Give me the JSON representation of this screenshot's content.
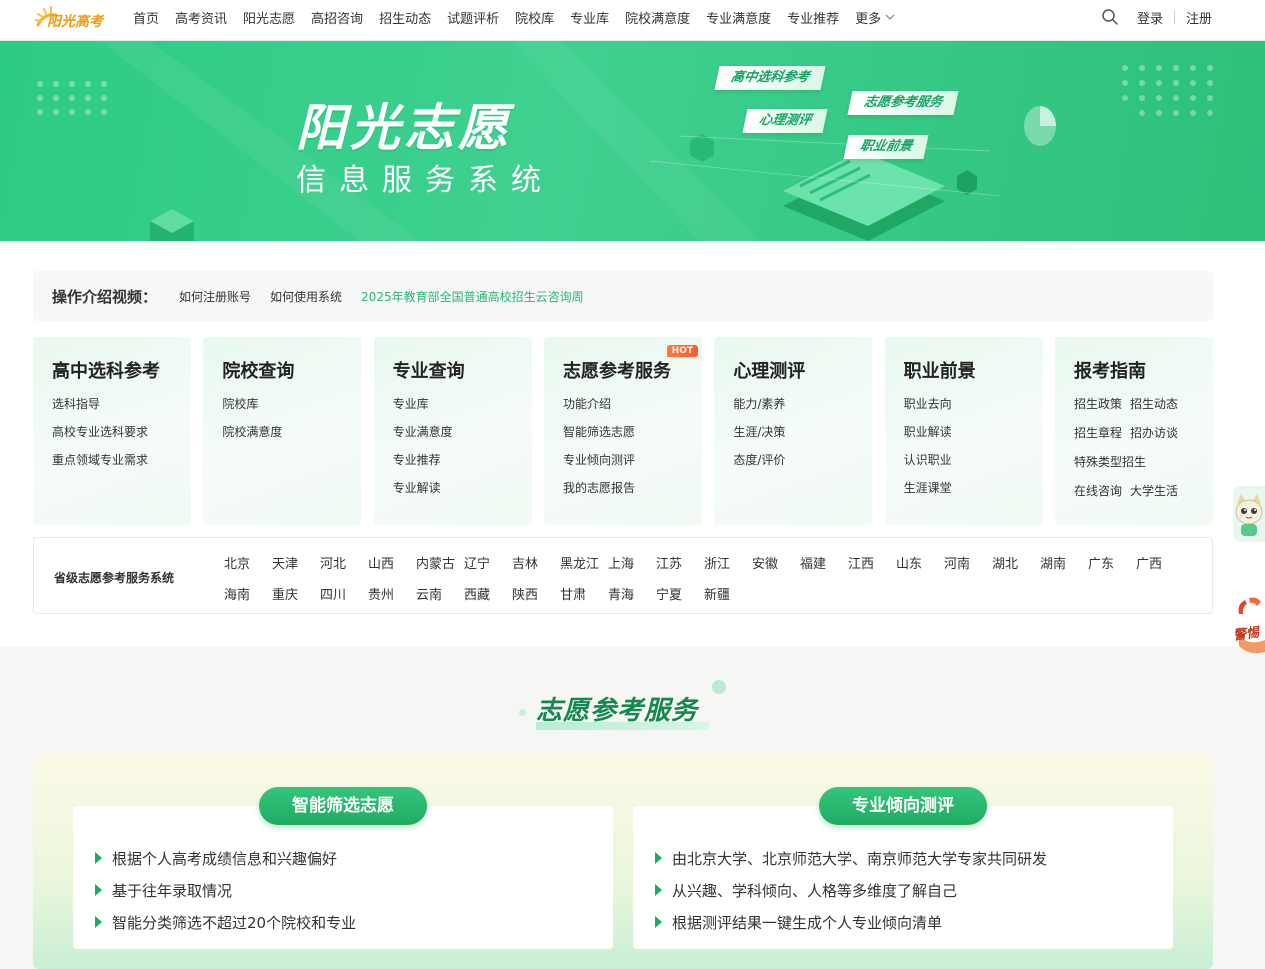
{
  "header": {
    "logo_text": "阳光高考",
    "nav": [
      "首页",
      "高考资讯",
      "阳光志愿",
      "高招咨询",
      "招生动态",
      "试题评析",
      "院校库",
      "专业库",
      "院校满意度",
      "专业满意度",
      "专业推荐"
    ],
    "more_label": "更多",
    "login": "登录",
    "register": "注册"
  },
  "banner": {
    "title": "阳光志愿",
    "subtitle": "信息服务系统",
    "tags": [
      "高中选科参考",
      "志愿参考服务",
      "心理测评",
      "职业前景"
    ]
  },
  "intro": {
    "label": "操作介绍视频：",
    "links": [
      "如何注册账号",
      "如何使用系统",
      "2025年教育部全国普通高校招生云咨询周"
    ]
  },
  "categories": [
    {
      "title": "高中选科参考",
      "links": [
        "选科指导",
        "高校专业选科要求",
        "重点领域专业需求"
      ]
    },
    {
      "title": "院校查询",
      "links": [
        "院校库",
        "院校满意度"
      ]
    },
    {
      "title": "专业查询",
      "links": [
        "专业库",
        "专业满意度",
        "专业推荐",
        "专业解读"
      ]
    },
    {
      "title": "志愿参考服务",
      "badge": "HOT",
      "links": [
        "功能介绍",
        "智能筛选志愿",
        "专业倾向测评",
        "我的志愿报告"
      ]
    },
    {
      "title": "心理测评",
      "links": [
        "能力/素养",
        "生涯/决策",
        "态度/评价"
      ]
    },
    {
      "title": "职业前景",
      "links": [
        "职业去向",
        "职业解读",
        "认识职业",
        "生涯课堂"
      ]
    },
    {
      "title": "报考指南",
      "links": [
        "招生政策",
        "招生动态",
        "招生章程",
        "招办访谈",
        "特殊类型招生",
        "在线咨询",
        "大学生活"
      ]
    }
  ],
  "provinces": {
    "label": "省级志愿参考服务系统",
    "row1": [
      "北京",
      "天津",
      "河北",
      "山西",
      "内蒙古",
      "辽宁",
      "吉林",
      "黑龙江",
      "上海",
      "江苏",
      "浙江",
      "安徽",
      "福建",
      "江西",
      "山东",
      "河南",
      "湖北",
      "湖南",
      "广东",
      "广西"
    ],
    "row2": [
      "海南",
      "重庆",
      "四川",
      "贵州",
      "云南",
      "西藏",
      "陕西",
      "甘肃",
      "青海",
      "宁夏",
      "新疆"
    ]
  },
  "service": {
    "title": "志愿参考服务",
    "cards": [
      {
        "pill": "智能筛选志愿",
        "items": [
          "根据个人高考成绩信息和兴趣偏好",
          "基于往年录取情况",
          "智能分类筛选不超过20个院校和专业"
        ]
      },
      {
        "pill": "专业倾向测评",
        "items": [
          "由北京大学、北京师范大学、南京师范大学专家共同研发",
          "从兴趣、学科倾向、人格等多维度了解自己",
          "根据测评结果一键生成个人专业倾向清单"
        ]
      }
    ]
  },
  "float": {
    "promo_text": "警惕"
  },
  "colors": {
    "brand_green": "#2bb673",
    "logo_orange": "#f19b18",
    "hot_red": "#ff5a2b"
  }
}
